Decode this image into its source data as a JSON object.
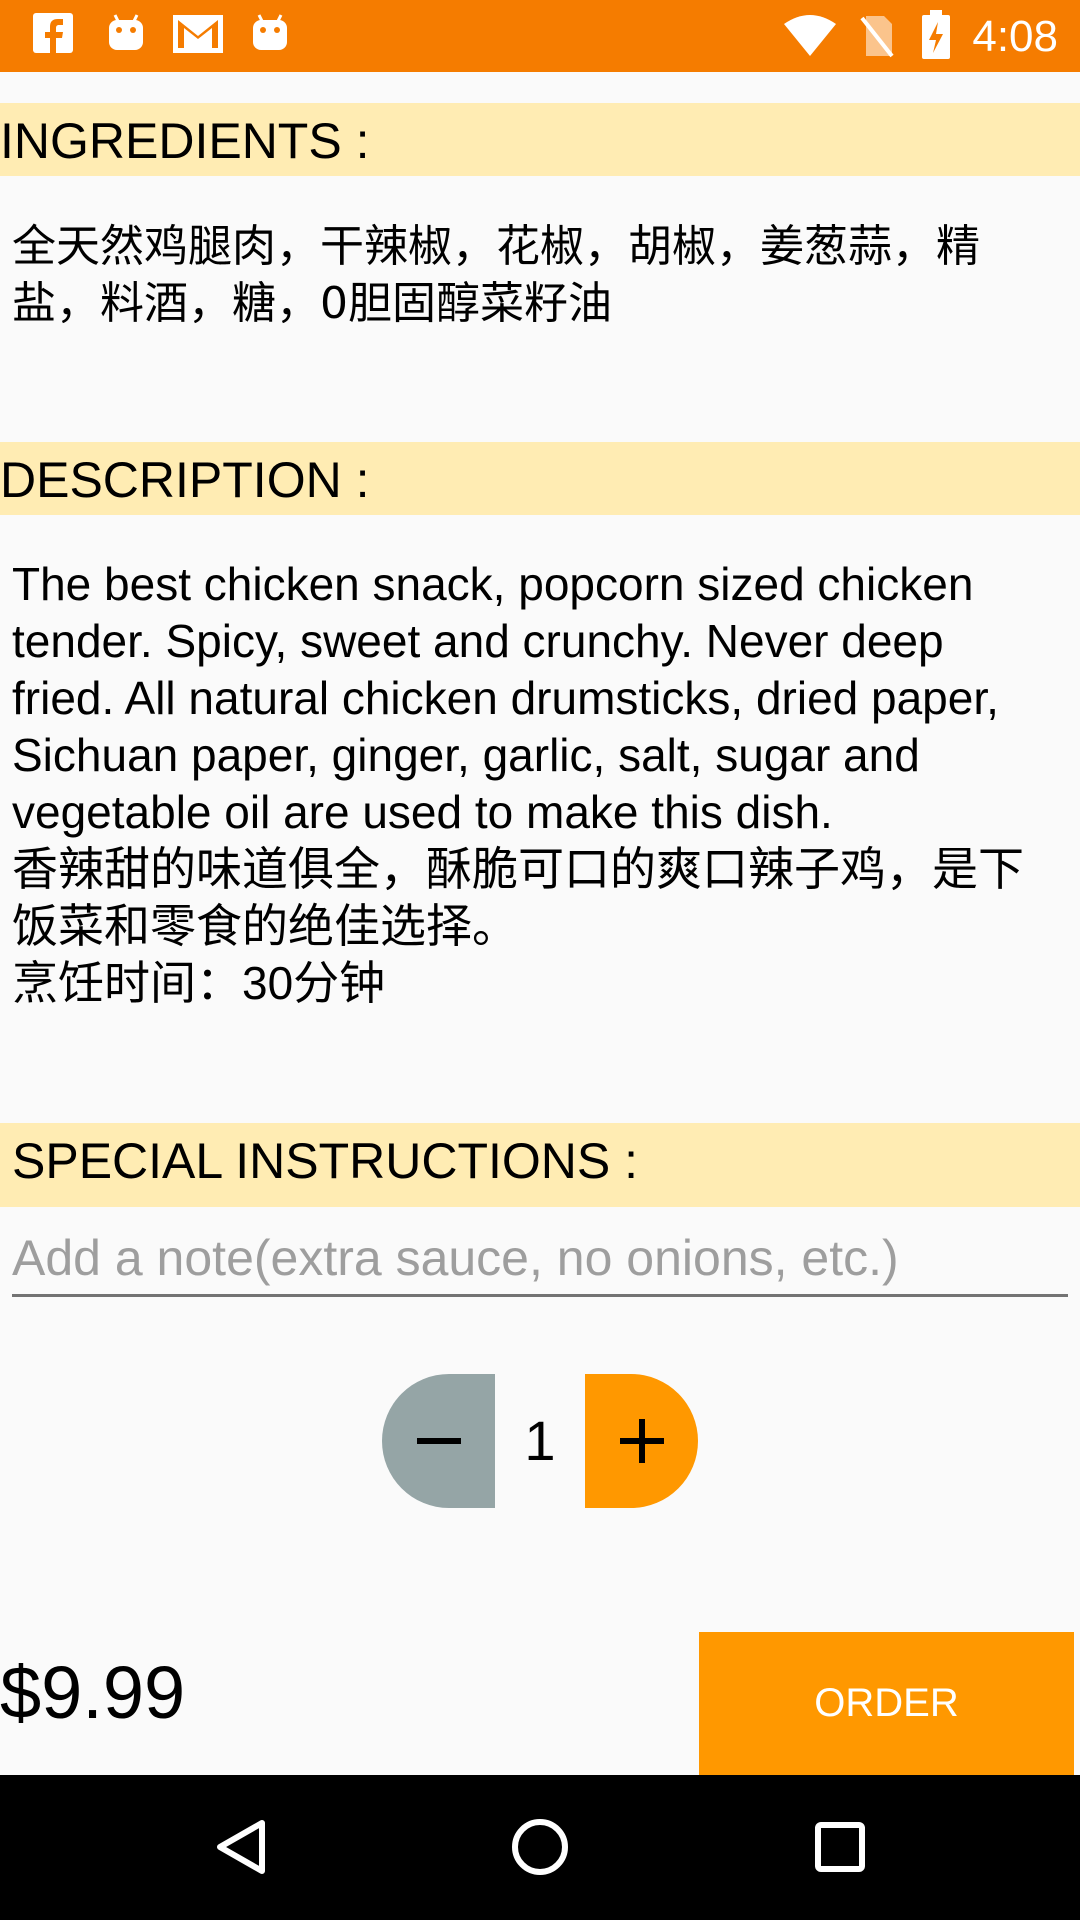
{
  "status_bar": {
    "time": "4:08",
    "left_icons": [
      "facebook-icon",
      "android-icon",
      "gmail-icon",
      "android-icon"
    ],
    "right_icons": [
      "wifi-icon",
      "no-sim-icon",
      "battery-charging-icon"
    ]
  },
  "sections": {
    "ingredients_title": "INGREDIENTS :",
    "ingredients_text": "全天然鸡腿肉，干辣椒，花椒，胡椒，姜葱蒜，精\n盐，料酒，糖，0胆固醇菜籽油",
    "description_title": "DESCRIPTION :",
    "description_text": "The best chicken snack, popcorn sized chicken\ntender. Spicy, sweet and crunchy. Never deep\nfried. All natural chicken drumsticks, dried paper,\nSichuan paper, ginger, garlic, salt, sugar and\nvegetable oil are used to make this dish.\n香辣甜的味道俱全，酥脆可口的爽口辣子鸡，是下\n饭菜和零食的绝佳选择。\n烹饪时间：30分钟",
    "special_title": "SPECIAL INSTRUCTIONS :"
  },
  "note": {
    "value": "",
    "placeholder": "Add a note(extra sauce, no onions, etc.)"
  },
  "quantity": {
    "value": "1",
    "minus_color": "#95a5a6",
    "plus_color": "#ff9800"
  },
  "footer": {
    "price": "$9.99",
    "order_label": "ORDER"
  },
  "nav": {
    "icons": [
      "back-icon",
      "home-icon",
      "recents-icon"
    ]
  },
  "colors": {
    "status_bar": "#f57c00",
    "accent": "#ff9800",
    "section_header": "#ffecb3"
  }
}
